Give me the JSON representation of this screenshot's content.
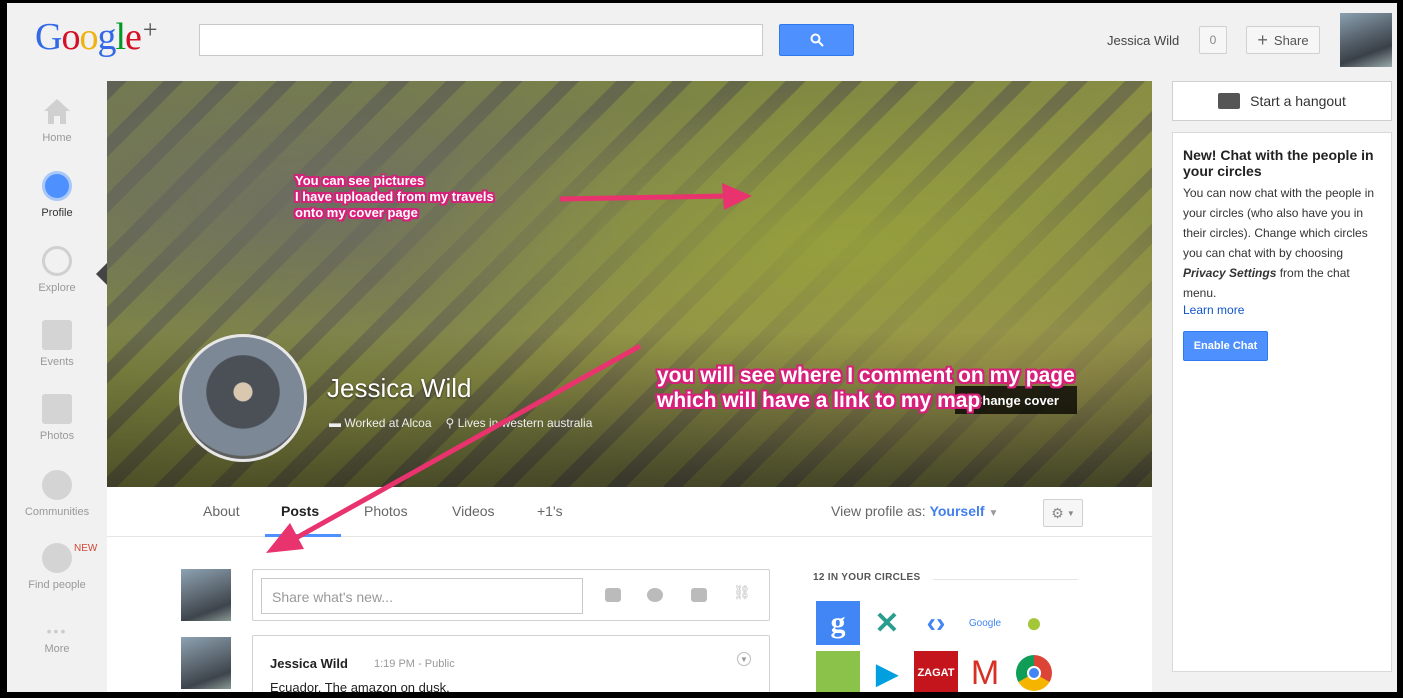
{
  "header": {
    "logo_text": "Google",
    "logo_plus": "+",
    "search_value": "",
    "user_name": "Jessica Wild",
    "notification_count": "0",
    "share_label": "Share"
  },
  "nav": {
    "items": [
      {
        "label": "Home",
        "icon": "home-icon"
      },
      {
        "label": "Profile",
        "icon": "profile-icon"
      },
      {
        "label": "Explore",
        "icon": "compass-icon"
      },
      {
        "label": "Events",
        "icon": "calendar-icon"
      },
      {
        "label": "Photos",
        "icon": "camera-icon"
      },
      {
        "label": "Communities",
        "icon": "communities-icon"
      },
      {
        "label": "Find people",
        "icon": "find-people-icon",
        "badge": "NEW"
      },
      {
        "label": "More",
        "icon": "more-icon"
      }
    ]
  },
  "profile": {
    "name": "Jessica Wild",
    "work": "Worked at Alcoa",
    "lives": "Lives in western australia",
    "change_cover": "Change cover"
  },
  "annotations": {
    "one_line1": "You can see pictures",
    "one_line2": "I have uploaded from my travels",
    "one_line3": "onto my cover page",
    "two_line1": "you will see where I comment on my page",
    "two_line2": "which will have a link to my map"
  },
  "tabs": {
    "items": [
      "About",
      "Posts",
      "Photos",
      "Videos",
      "+1's"
    ],
    "active": "Posts",
    "view_profile_label": "View profile as:",
    "view_profile_value": "Yourself"
  },
  "share_box": {
    "placeholder": "Share what's new..."
  },
  "post": {
    "author": "Jessica Wild",
    "time": "1:19 PM",
    "visibility": "Public",
    "text": "Ecuador, The amazon on dusk."
  },
  "circles": {
    "heading": "12 IN YOUR CIRCLES"
  },
  "hangout": {
    "label": "Start a hangout"
  },
  "chat": {
    "title": "New! Chat with the people in your circles",
    "body_1": "You can now chat with the people in your circles (who also have you in their circles). Change which circles you can chat with by choosing ",
    "body_bold": "Privacy Settings",
    "body_2": " from the chat menu.",
    "learn_more": "Learn more",
    "enable_label": "Enable Chat"
  },
  "colors": {
    "accent": "#4d90fe",
    "annotation": "#d6207a",
    "link": "#1155cc"
  }
}
